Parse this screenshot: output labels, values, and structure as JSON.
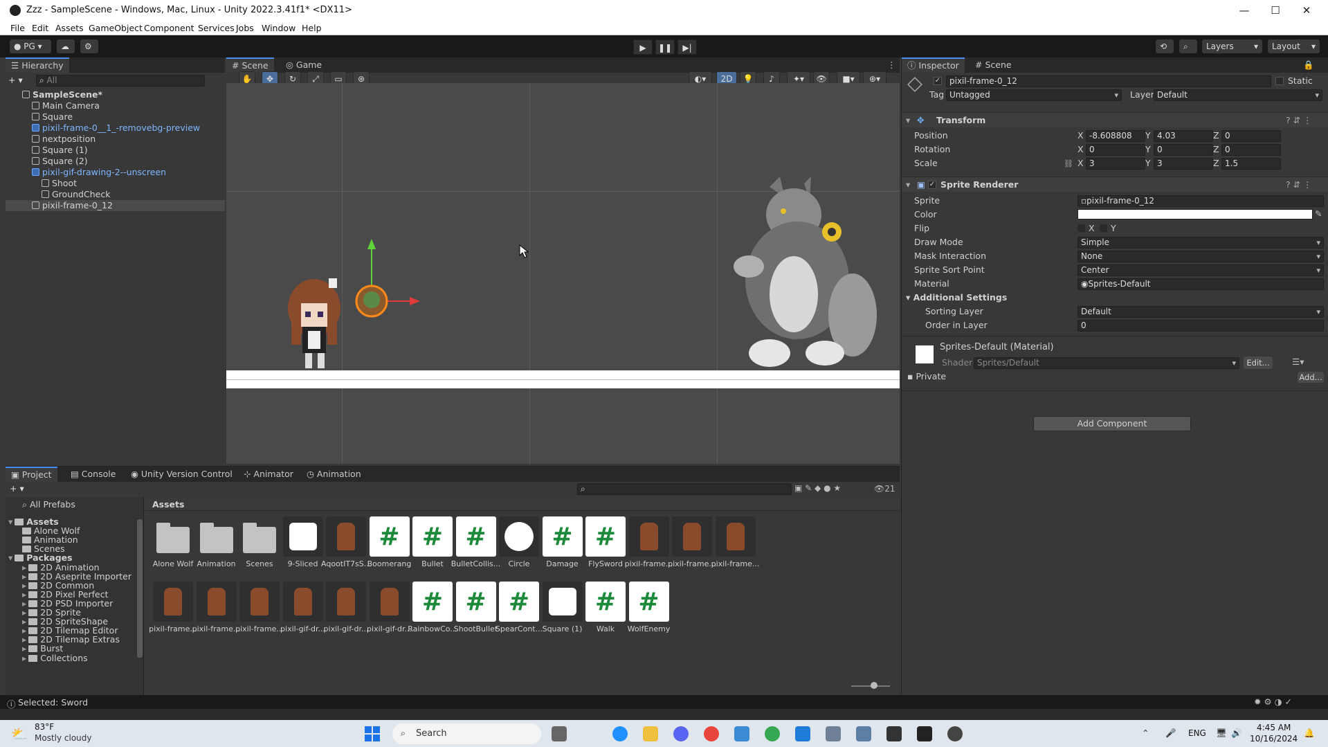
{
  "window": {
    "title": "Zzz - SampleScene - Windows, Mac, Linux - Unity 2022.3.41f1* <DX11>"
  },
  "menu": [
    "File",
    "Edit",
    "Assets",
    "GameObject",
    "Component",
    "Services",
    "Jobs",
    "Window",
    "Help"
  ],
  "toolbar": {
    "account": "PG",
    "layers": "Layers",
    "layout": "Layout"
  },
  "hierarchy": {
    "tab": "Hierarchy",
    "search_placeholder": "All",
    "items": [
      {
        "label": "SampleScene*",
        "indent": 0,
        "type": "scene"
      },
      {
        "label": "Main Camera",
        "indent": 1,
        "type": "object"
      },
      {
        "label": "Square",
        "indent": 1,
        "type": "object"
      },
      {
        "label": "pixil-frame-0__1_-removebg-preview",
        "indent": 1,
        "type": "prefab"
      },
      {
        "label": "nextposition",
        "indent": 1,
        "type": "object"
      },
      {
        "label": "Square (1)",
        "indent": 1,
        "type": "object"
      },
      {
        "label": "Square (2)",
        "indent": 1,
        "type": "object"
      },
      {
        "label": "pixil-gif-drawing-2--unscreen",
        "indent": 1,
        "type": "prefab"
      },
      {
        "label": "Shoot",
        "indent": 2,
        "type": "object"
      },
      {
        "label": "GroundCheck",
        "indent": 2,
        "type": "object"
      },
      {
        "label": "pixil-frame-0_12",
        "indent": 1,
        "type": "object"
      }
    ]
  },
  "scene_tabs": {
    "scene": "Scene",
    "game": "Game",
    "mode_2d": "2D"
  },
  "inspector": {
    "tab": "Inspector",
    "tab2": "Scene",
    "object_name": "pixil-frame-0_12",
    "static_label": "Static",
    "tag_label": "Tag",
    "tag_value": "Untagged",
    "layer_label": "Layer",
    "layer_value": "Default",
    "transform": {
      "title": "Transform",
      "position_label": "Position",
      "position": [
        "-8.608808",
        "4.03",
        "0"
      ],
      "rotation_label": "Rotation",
      "rotation": [
        "0",
        "0",
        "0"
      ],
      "scale_label": "Scale",
      "scale": [
        "3",
        "3",
        "1.5"
      ]
    },
    "sprite_renderer": {
      "title": "Sprite Renderer",
      "sprite_label": "Sprite",
      "sprite_value": "pixil-frame-0_12",
      "color_label": "Color",
      "color_value": "#ffffff",
      "flip_label": "Flip",
      "flip_x": "X",
      "flip_y": "Y",
      "draw_mode_label": "Draw Mode",
      "draw_mode_value": "Simple",
      "mask_label": "Mask Interaction",
      "mask_value": "None",
      "sort_point_label": "Sprite Sort Point",
      "sort_point_value": "Center",
      "material_label": "Material",
      "material_value": "Sprites-Default",
      "additional_settings": "Additional Settings",
      "sorting_layer_label": "Sorting Layer",
      "sorting_layer_value": "Default",
      "order_label": "Order in Layer",
      "order_value": "0"
    },
    "material": {
      "title": "Sprites-Default (Material)",
      "shader_label": "Shader",
      "shader_value": "Sprites/Default",
      "edit_button": "Edit...",
      "private_label": "Private",
      "add_button": "Add..."
    },
    "add_component": "Add Component"
  },
  "bottom_tabs": [
    "Project",
    "Console",
    "Unity Version Control",
    "Animator",
    "Animation"
  ],
  "project": {
    "search_count": "21",
    "left_tree": [
      {
        "label": "All Prefabs",
        "level": 0,
        "kind": "search"
      },
      {
        "label": "Assets",
        "level": 0,
        "kind": "root"
      },
      {
        "label": "Alone Wolf",
        "level": 1,
        "kind": "folder"
      },
      {
        "label": "Animation",
        "level": 1,
        "kind": "folder"
      },
      {
        "label": "Scenes",
        "level": 1,
        "kind": "folder"
      },
      {
        "label": "Packages",
        "level": 0,
        "kind": "root"
      },
      {
        "label": "2D Animation",
        "level": 1,
        "kind": "folder"
      },
      {
        "label": "2D Aseprite Importer",
        "level": 1,
        "kind": "folder"
      },
      {
        "label": "2D Common",
        "level": 1,
        "kind": "folder"
      },
      {
        "label": "2D Pixel Perfect",
        "level": 1,
        "kind": "folder"
      },
      {
        "label": "2D PSD Importer",
        "level": 1,
        "kind": "folder"
      },
      {
        "label": "2D Sprite",
        "level": 1,
        "kind": "folder"
      },
      {
        "label": "2D SpriteShape",
        "level": 1,
        "kind": "folder"
      },
      {
        "label": "2D Tilemap Editor",
        "level": 1,
        "kind": "folder"
      },
      {
        "label": "2D Tilemap Extras",
        "level": 1,
        "kind": "folder"
      },
      {
        "label": "Burst",
        "level": 1,
        "kind": "folder"
      },
      {
        "label": "Collections",
        "level": 1,
        "kind": "folder"
      }
    ],
    "breadcrumb": "Assets",
    "assets_row1": [
      {
        "label": "Alone Wolf",
        "kind": "folder"
      },
      {
        "label": "Animation",
        "kind": "folder"
      },
      {
        "label": "Scenes",
        "kind": "folder"
      },
      {
        "label": "9-Sliced",
        "kind": "white-square"
      },
      {
        "label": "AqootIT7sS...",
        "kind": "sprite"
      },
      {
        "label": "Boomerang",
        "kind": "script"
      },
      {
        "label": "Bullet",
        "kind": "script"
      },
      {
        "label": "BulletCollis...",
        "kind": "script"
      },
      {
        "label": "Circle",
        "kind": "circle"
      },
      {
        "label": "Damage",
        "kind": "script"
      },
      {
        "label": "FlySword",
        "kind": "script"
      },
      {
        "label": "pixil-frame...",
        "kind": "sprite"
      },
      {
        "label": "pixil-frame...",
        "kind": "sprite"
      },
      {
        "label": "pixil-frame...",
        "kind": "sprite"
      }
    ],
    "assets_row2": [
      {
        "label": "pixil-frame...",
        "kind": "sprite"
      },
      {
        "label": "pixil-frame...",
        "kind": "sprite"
      },
      {
        "label": "pixil-frame...",
        "kind": "sprite"
      },
      {
        "label": "pixil-gif-dr...",
        "kind": "sprite"
      },
      {
        "label": "pixil-gif-dr...",
        "kind": "sprite"
      },
      {
        "label": "pixil-gif-dr...",
        "kind": "sprite"
      },
      {
        "label": "RainbowCo...",
        "kind": "script"
      },
      {
        "label": "ShootBullet",
        "kind": "script"
      },
      {
        "label": "SpearCont...",
        "kind": "script"
      },
      {
        "label": "Square (1)",
        "kind": "white-square"
      },
      {
        "label": "Walk",
        "kind": "script"
      },
      {
        "label": "WolfEnemy",
        "kind": "script"
      }
    ]
  },
  "status": {
    "text": "Selected: Sword"
  },
  "taskbar": {
    "weather_temp": "83°F",
    "weather_desc": "Mostly cloudy",
    "search": "Search",
    "lang": "ENG",
    "time": "4:45 AM",
    "date": "10/16/2024"
  },
  "colors": {
    "accent": "#4b8cf0",
    "script_green": "#1c8a3a",
    "panel": "#383838"
  }
}
